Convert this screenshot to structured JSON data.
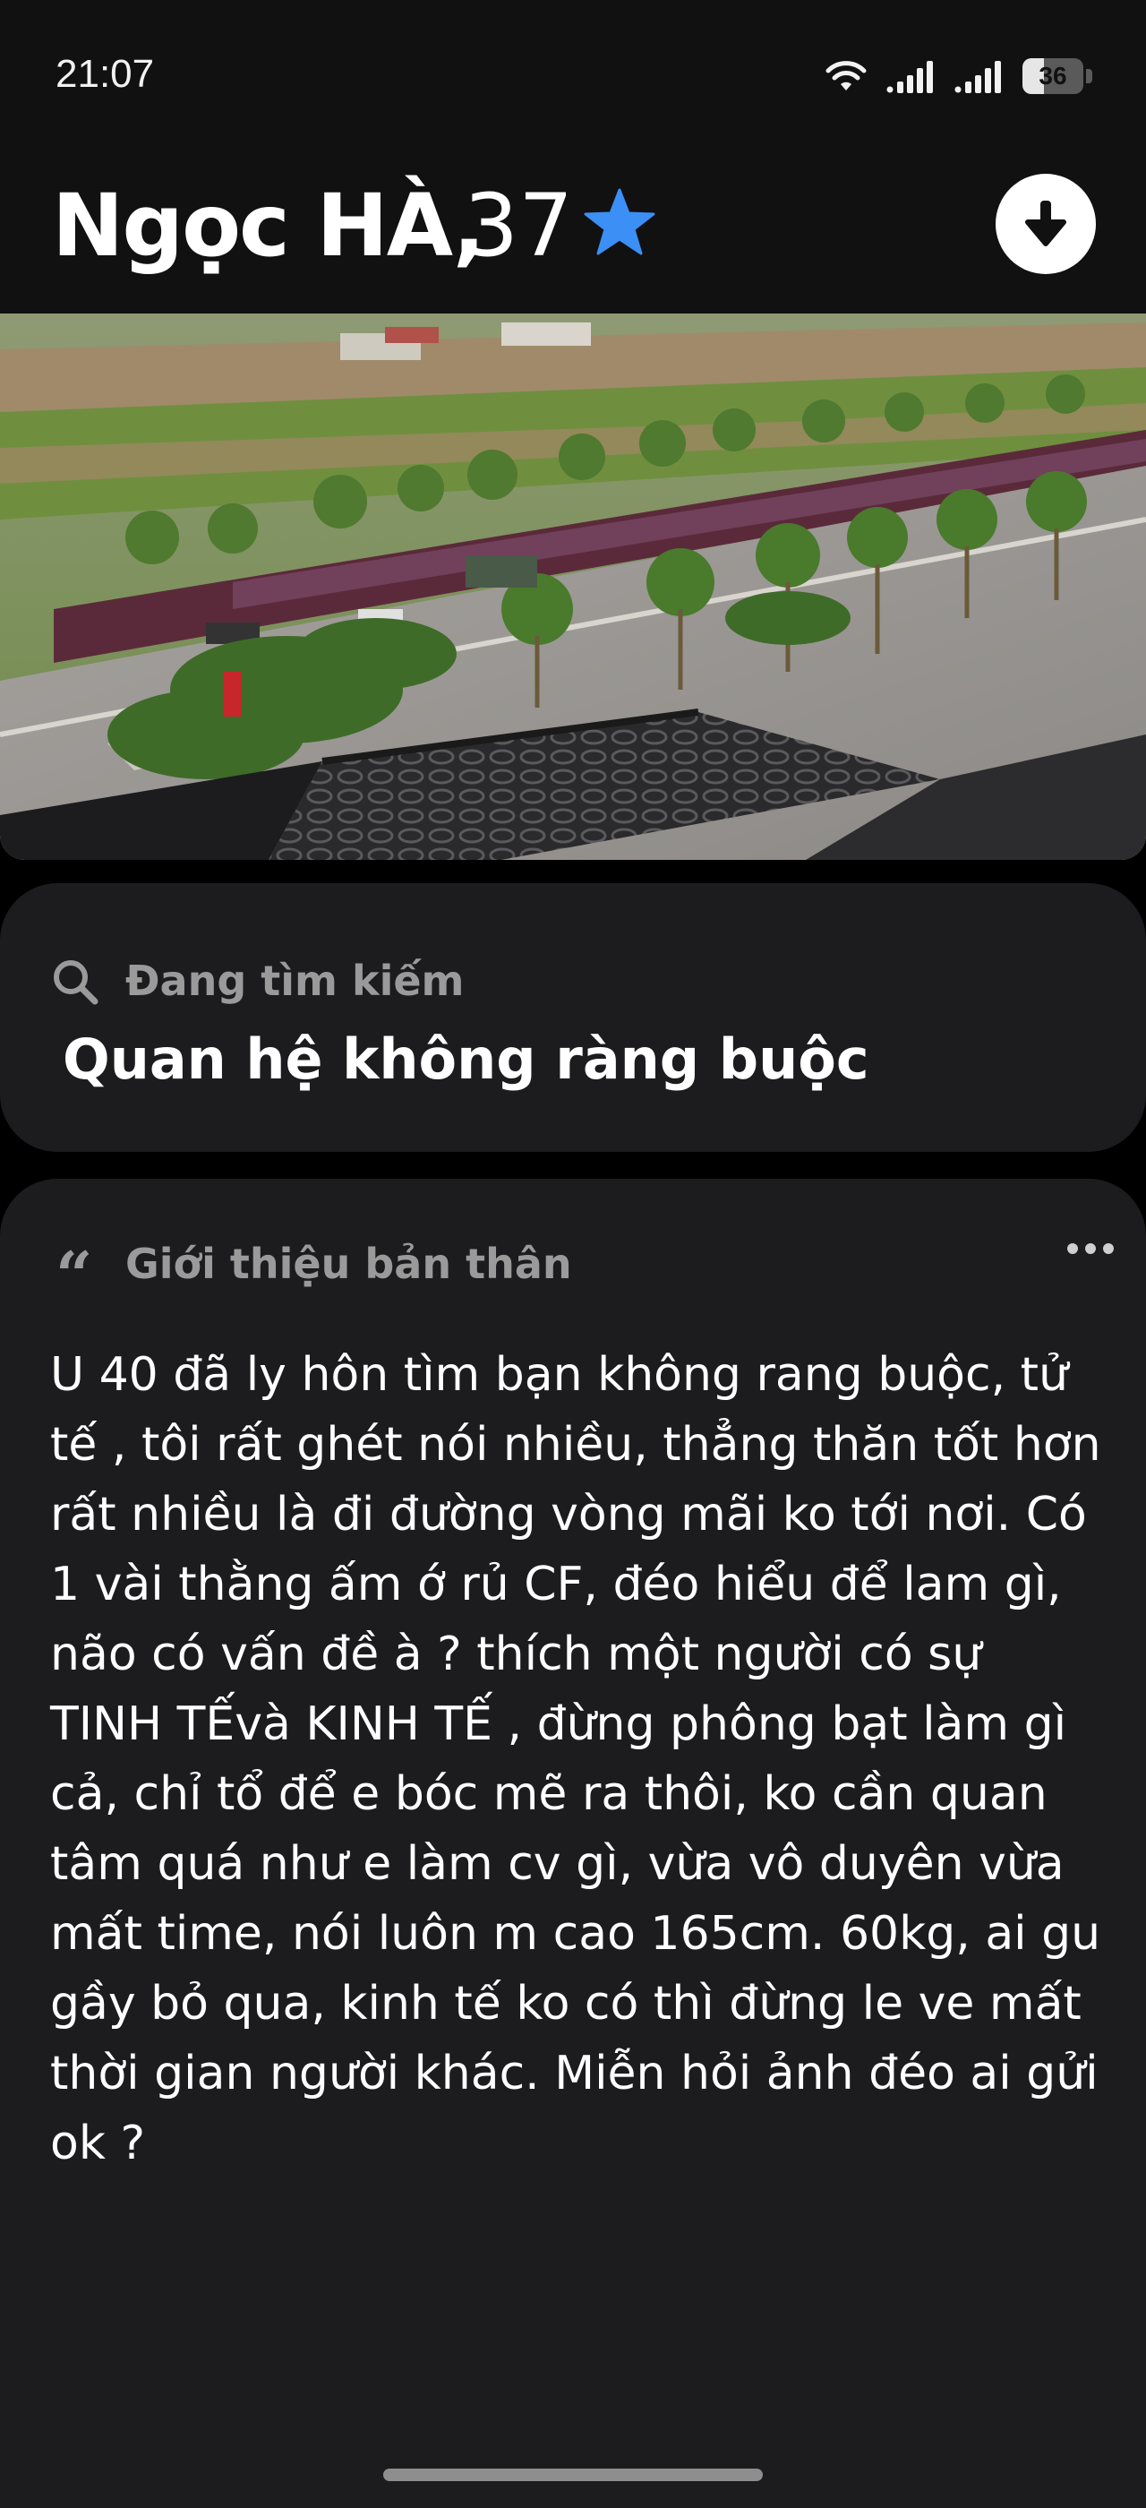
{
  "status_bar": {
    "time": "21:07",
    "battery_level": "36",
    "icons": [
      "wifi-icon",
      "signal-icon",
      "signal-icon",
      "battery-icon"
    ]
  },
  "profile": {
    "name": "Ngọc HÀ,",
    "age": "37",
    "badge_icon": "star-icon",
    "action_icon": "download-icon"
  },
  "looking_for": {
    "label": "Đang tìm kiếm",
    "value": "Quan hệ không ràng buộc",
    "icon": "search-icon"
  },
  "bio": {
    "label": "Giới thiệu bản thân",
    "icon": "quote-icon",
    "menu_icon": "more-icon",
    "text": "U 40 đã ly hôn tìm bạn không rang buộc, tử tế , tôi rất ghét nói nhiều, thẳng thăn tốt hơn rất nhiều là đi đường vòng mãi ko tới nơi. Có 1 vài thằng ấm ớ rủ CF, đéo hiểu để lam gì, não có vấn đề à ? thích một người có sự TINH TẾvà  KINH TẾ , đừng phông bạt làm gì cả, chỉ tổ để e bóc mẽ ra thôi, ko cần quan tâm quá như e làm cv gì, vừa vô duyên vừa mất time, nói luôn m cao 165cm. 60kg, ai gu gầy bỏ qua, kinh tế ko có thì đừng le ve mất thời gian người khác.  Miễn hỏi ảnh đéo ai gửi ok ?"
  },
  "colors": {
    "background": "#000000",
    "card": "#1c1c1e",
    "label": "#9a9a9a",
    "star": "#3b8ff5"
  }
}
